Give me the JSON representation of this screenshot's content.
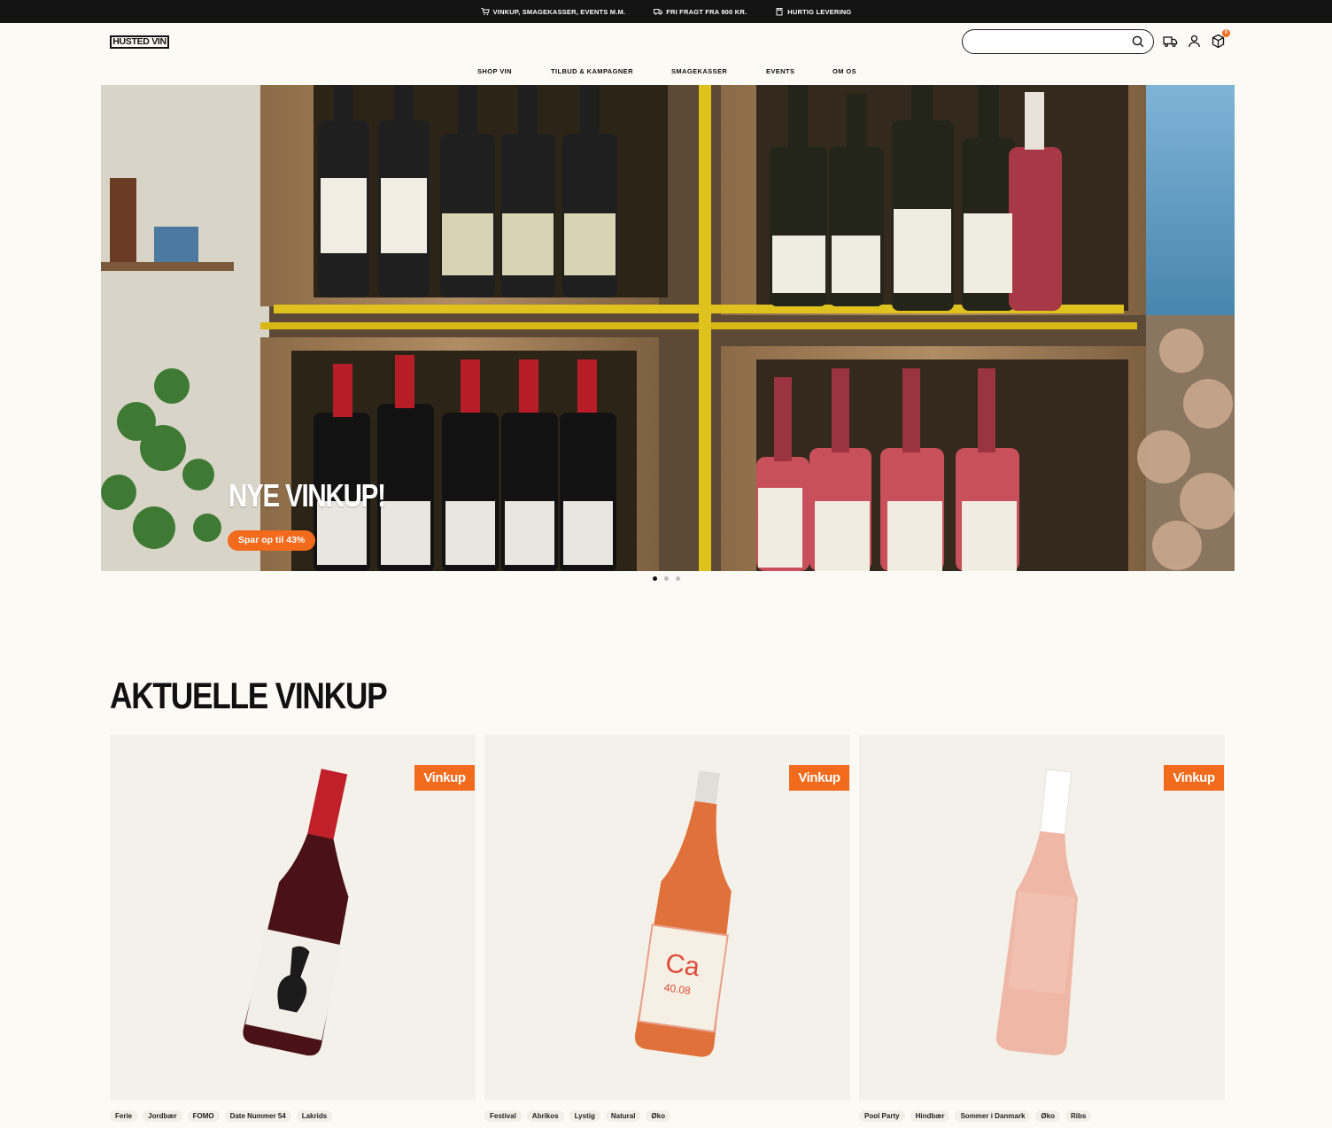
{
  "topbar": {
    "usp1": "VINKUP, SMAGEKASSER, EVENTS M.M.",
    "usp2": "FRI FRAGT FRA 900 KR.",
    "usp3": "HURTIG LEVERING"
  },
  "header": {
    "logo": "HUSTED VIN",
    "search_placeholder": "",
    "cart_count": "0"
  },
  "nav": [
    "SHOP VIN",
    "TILBUD & KAMPAGNER",
    "SMAGEKASSER",
    "EVENTS",
    "OM OS"
  ],
  "hero": {
    "title": "NYE VINKUP!",
    "cta": "Spar op til 43%",
    "slides": 3,
    "active_slide": 1
  },
  "section": {
    "title": "AKTUELLE VINKUP"
  },
  "products": [
    {
      "badge": "Vinkup",
      "tags": [
        "Ferie",
        "Jordbær",
        "FOMO",
        "Date Nummer 54",
        "Lakrids"
      ],
      "wine_color": "#5a1418",
      "cap_color": "#c0202a",
      "label_color": "#f2efe8"
    },
    {
      "badge": "Vinkup",
      "tags": [
        "Festival",
        "Abrikos",
        "Lystig",
        "Natural",
        "Øko"
      ],
      "wine_color": "#e0713a",
      "cap_color": "#d9d6cf",
      "label_color": "#f6efe3"
    },
    {
      "badge": "Vinkup",
      "tags": [
        "Pool Party",
        "Hindbær",
        "Sommer i Danmark",
        "Øko",
        "Ribs"
      ],
      "wine_color": "#efb7a6",
      "cap_color": "#ffffff",
      "label_color": "#f4c3b5"
    }
  ],
  "colors": {
    "accent": "#f26b1d",
    "topbar": "#141414",
    "background": "#fbfaf5"
  }
}
